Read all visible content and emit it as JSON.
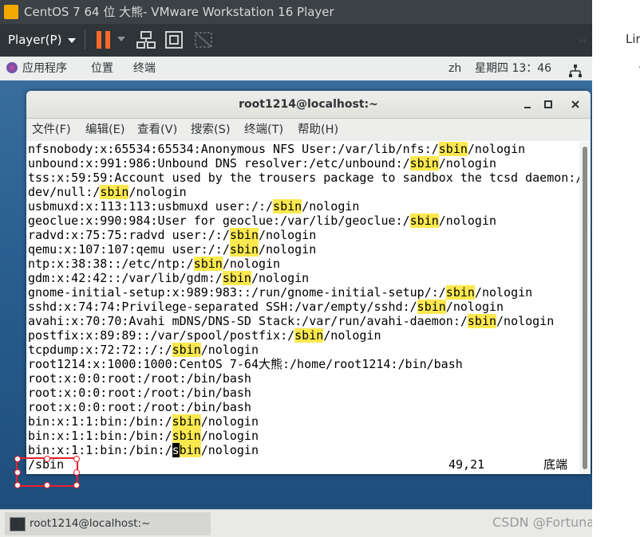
{
  "vmware": {
    "title": "CentOS 7 64 位 大熊- VMware Workstation 16 Player",
    "player_menu": "Player(P)"
  },
  "gnome_panel": {
    "applications": "应用程序",
    "places": "位置",
    "terminal": "终端",
    "language": "zh",
    "clock": "星期四 13：46"
  },
  "terminal": {
    "title": "root1214@localhost:~",
    "menu": [
      "文件(F)",
      "编辑(E)",
      "查看(V)",
      "搜索(S)",
      "终端(T)",
      "帮助(H)"
    ],
    "lines": [
      [
        "nfsnobody:x:65534:65534:Anonymous NFS User:/var/lib/nfs:/",
        "sbin",
        "/nologin"
      ],
      [
        "unbound:x:991:986:Unbound DNS resolver:/etc/unbound:/",
        "sbin",
        "/nologin"
      ],
      [
        "tss:x:59:59:Account used by the trousers package to sandbox the tcsd daemon:/",
        "",
        ""
      ],
      [
        "dev/null:/",
        "sbin",
        "/nologin"
      ],
      [
        "usbmuxd:x:113:113:usbmuxd user:/:/",
        "sbin",
        "/nologin"
      ],
      [
        "geoclue:x:990:984:User for geoclue:/var/lib/geoclue:/",
        "sbin",
        "/nologin"
      ],
      [
        "radvd:x:75:75:radvd user:/:/",
        "sbin",
        "/nologin"
      ],
      [
        "qemu:x:107:107:qemu user:/:/",
        "sbin",
        "/nologin"
      ],
      [
        "ntp:x:38:38::/etc/ntp:/",
        "sbin",
        "/nologin"
      ],
      [
        "gdm:x:42:42::/var/lib/gdm:/",
        "sbin",
        "/nologin"
      ],
      [
        "gnome-initial-setup:x:989:983::/run/gnome-initial-setup/:/",
        "sbin",
        "/nologin"
      ],
      [
        "sshd:x:74:74:Privilege-separated SSH:/var/empty/sshd:/",
        "sbin",
        "/nologin"
      ],
      [
        "avahi:x:70:70:Avahi mDNS/DNS-SD Stack:/var/run/avahi-daemon:/",
        "sbin",
        "/nologin"
      ],
      [
        "postfix:x:89:89::/var/spool/postfix:/",
        "sbin",
        "/nologin"
      ],
      [
        "tcpdump:x:72:72::/:/",
        "sbin",
        "/nologin"
      ],
      [
        "root1214:x:1000:1000:CentOS 7-64大熊:/home/root1214:/bin/bash",
        "",
        ""
      ],
      [
        "root:x:0:0:root:/root:/bin/bash",
        "",
        ""
      ],
      [
        "root:x:0:0:root:/root:/bin/bash",
        "",
        ""
      ],
      [
        "root:x:0:0:root:/root:/bin/bash",
        "",
        ""
      ],
      [
        "bin:x:1:1:bin:/bin:/",
        "sbin",
        "/nologin"
      ],
      [
        "bin:x:1:1:bin:/bin:/",
        "sbin",
        "/nologin"
      ],
      [
        "bin:x:1:1:bin:/bin:/",
        "sbin",
        "/nologin"
      ]
    ],
    "cursor_line": 21,
    "search_command": "/sbin",
    "cursor_position": "49,21",
    "scroll_position": "底端"
  },
  "taskbar": {
    "terminal_task": "root1214@localhost:~"
  },
  "watermark": "CSDN @Fortunate.F",
  "outside": {
    "text": "Lir",
    "dot": "."
  },
  "colors": {
    "highlight": "#fce94f",
    "pause_accent": "#ff6a2b",
    "annotation": "#e8212b"
  }
}
